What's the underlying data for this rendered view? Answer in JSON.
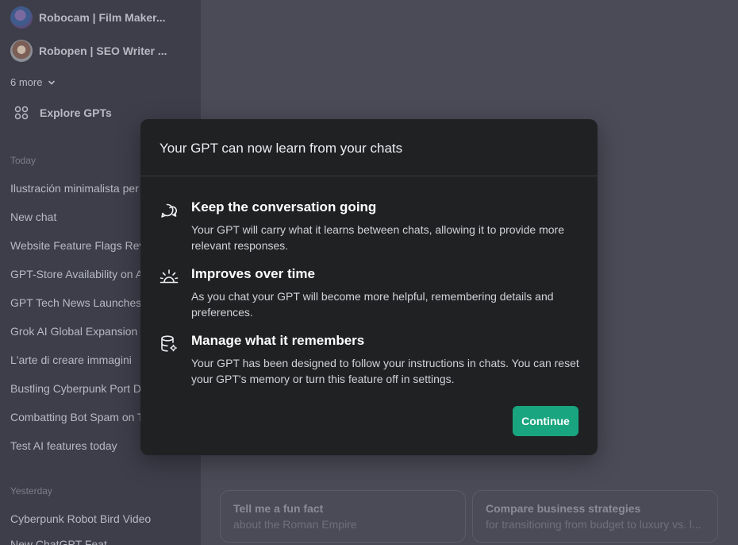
{
  "sidebar": {
    "gpts": [
      {
        "label": "Robocam | Film Maker..."
      },
      {
        "label": "Robopen | SEO Writer ..."
      }
    ],
    "more_label": "6 more",
    "explore_label": "Explore GPTs",
    "today_label": "Today",
    "today_chats": [
      "Ilustración minimalista per",
      "New chat",
      "Website Feature Flags Rev",
      "GPT-Store Availability on A",
      "GPT Tech News Launches",
      "Grok AI Global Expansion",
      "L'arte di creare immagini",
      "Bustling Cyberpunk Port D",
      "Combatting Bot Spam on T",
      "Test AI features today"
    ],
    "yesterday_label": "Yesterday",
    "yesterday_chats": [
      "Cyberpunk Robot Bird Video",
      "New ChatGPT Feat"
    ]
  },
  "suggestions": [
    {
      "title": "Tell me a fun fact",
      "subtitle": "about the Roman Empire"
    },
    {
      "title": "Compare business strategies",
      "subtitle": "for transitioning from budget to luxury vs. l..."
    }
  ],
  "modal": {
    "title": "Your GPT can now learn from your chats",
    "features": [
      {
        "icon": "chat-bubbles-icon",
        "heading": "Keep the conversation going",
        "body": "Your GPT will carry what it learns between chats, allowing it to provide more relevant responses."
      },
      {
        "icon": "sunrise-icon",
        "heading": "Improves over time",
        "body": "As you chat your GPT will become more helpful, remembering details and preferences."
      },
      {
        "icon": "database-settings-icon",
        "heading": "Manage what it remembers",
        "body": "Your GPT has been designed to follow your instructions in chats. You can reset your GPT's memory or turn this feature off in settings."
      }
    ],
    "continue_label": "Continue"
  },
  "colors": {
    "accent": "#19a57f",
    "modal_bg": "#202123",
    "sidebar_bg": "#3d3e4a",
    "main_bg": "#4a4b57"
  }
}
